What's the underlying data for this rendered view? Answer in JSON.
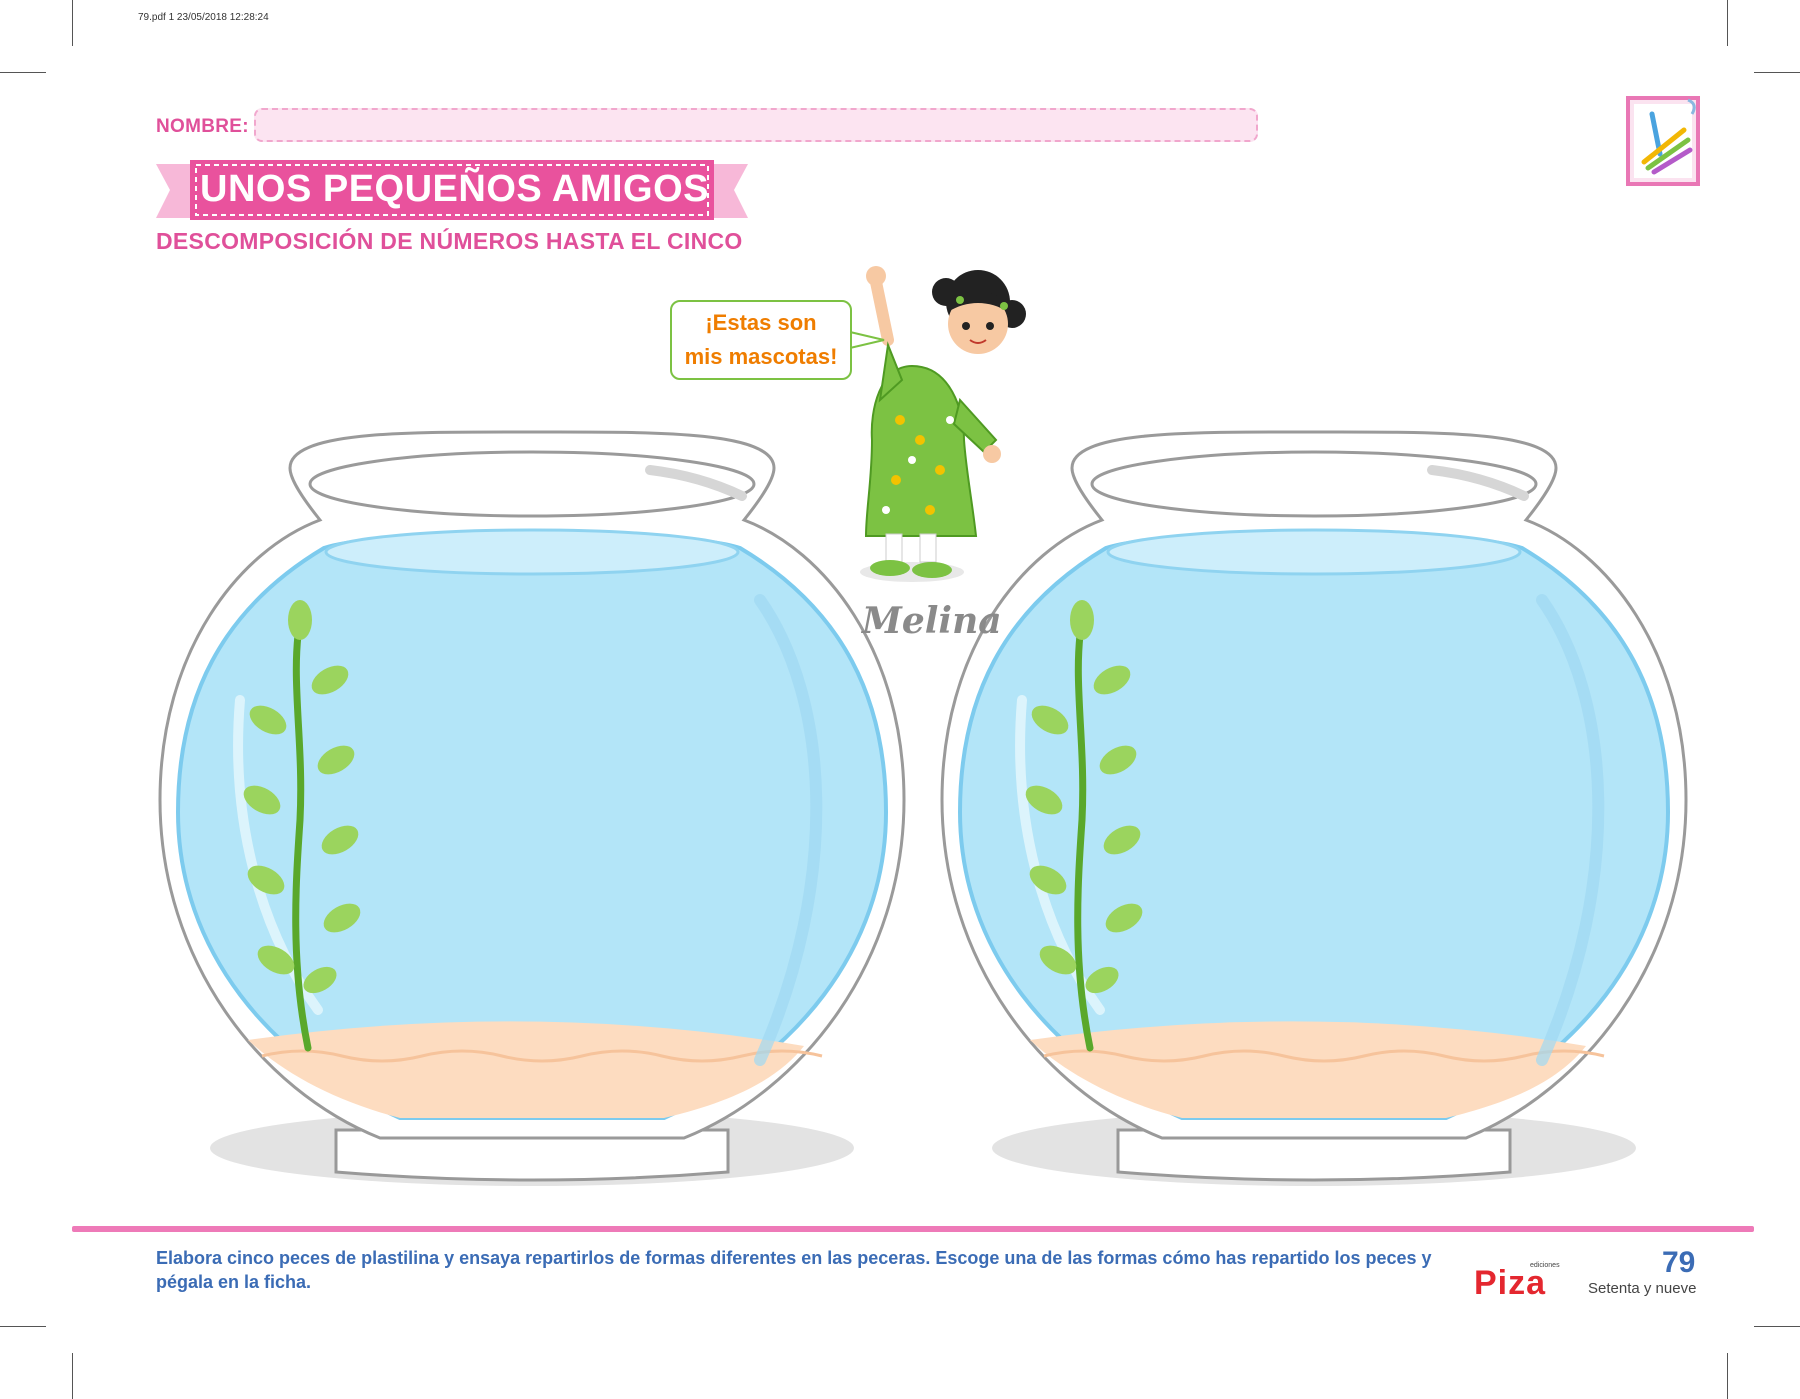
{
  "print_info": "79.pdf  1  23/05/2018  12:28:24",
  "header": {
    "name_label": "NOMBRE:",
    "title": "UNOS PEQUEÑOS AMIGOS",
    "subtitle": "DESCOMPOSICIÓN DE NÚMEROS HASTA EL CINCO"
  },
  "character": {
    "speech": "¡Estas son\nmis mascotas!",
    "name": "Melina"
  },
  "footer": {
    "instruction": "Elabora cinco peces de plastilina y ensaya repartirlos de formas diferentes en las peceras. Escoge una de las formas cómo has repartido los peces y pégala en la ficha.",
    "publisher": "Piza",
    "publisher_small": "ediciones",
    "page_number": "79",
    "page_words": "Setenta y nueve"
  },
  "colors": {
    "accent_pink": "#e0509a",
    "water": "#b3e5f8",
    "sand": "#fddcc0",
    "plant": "#7cc243",
    "instruction_blue": "#3b6cb5"
  }
}
